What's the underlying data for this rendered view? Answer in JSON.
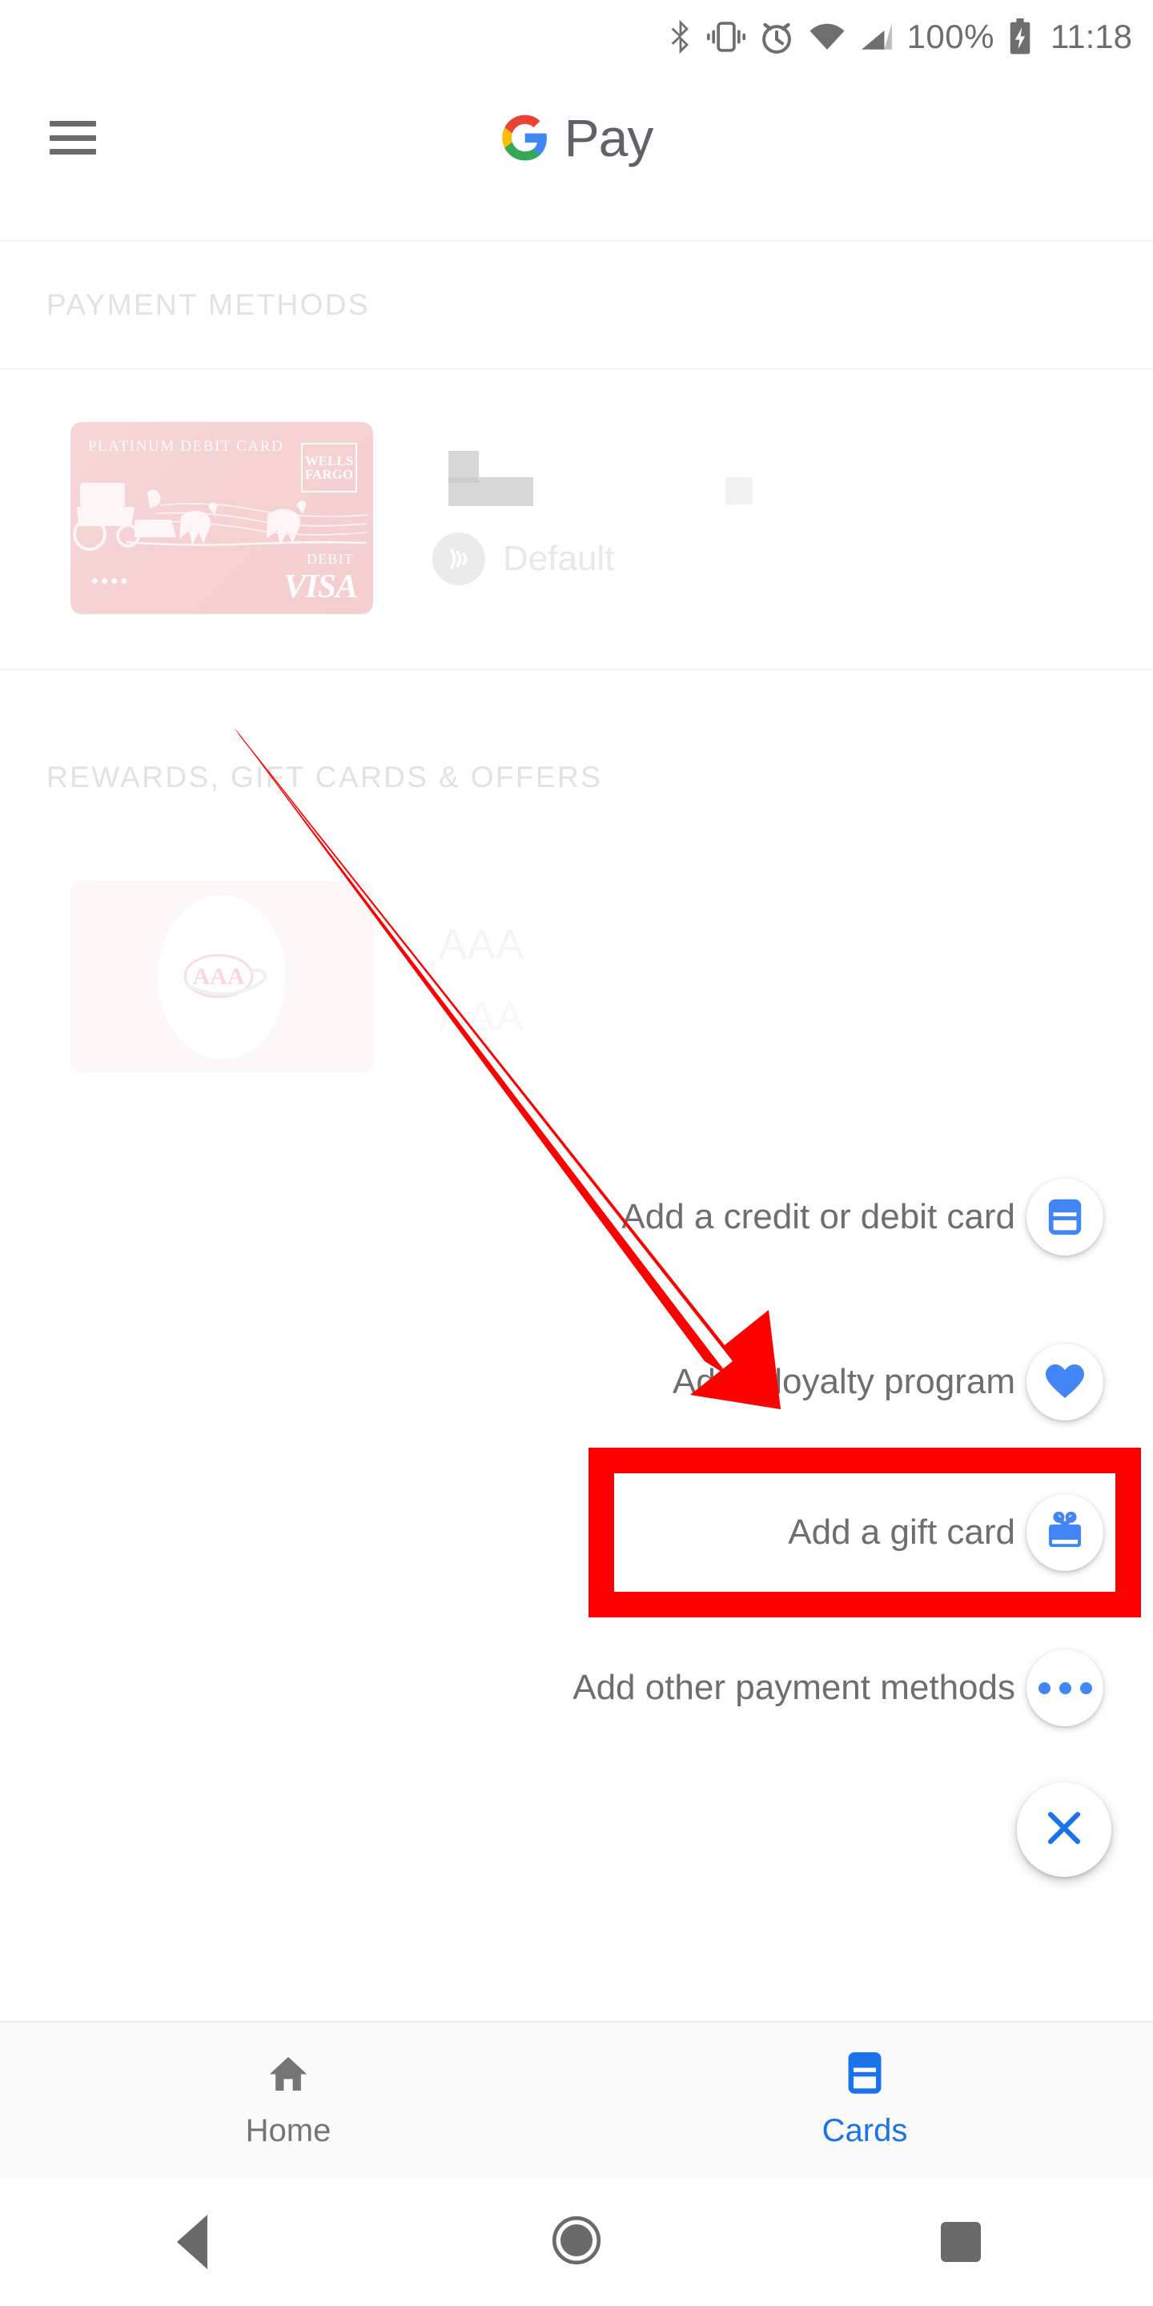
{
  "status_bar": {
    "icons": [
      "bluetooth-icon",
      "vibrate-icon",
      "alarm-icon",
      "wifi-icon",
      "cell-signal-icon"
    ],
    "battery_percent": "100%",
    "battery_state": "charging",
    "time": "11:18"
  },
  "app_bar": {
    "menu_icon": "hamburger-menu-icon",
    "brand_word": "Pay",
    "logo_icon": "google-g-logo"
  },
  "sections": [
    {
      "title": "PAYMENT METHODS"
    },
    {
      "title": "REWARDS, GIFT CARDS & OFFERS"
    }
  ],
  "payment_card": {
    "product_name": "PLATINUM DEBIT CARD",
    "bank_line1": "WELLS",
    "bank_line2": "FARGO",
    "masked_digits": "••••",
    "network_type": "DEBIT",
    "network": "VISA",
    "status_label": "Default",
    "status_icon": "contactless-nfc-icon"
  },
  "loyalty_card": {
    "name": "AAA",
    "secondary": "AAA",
    "logo_icon": "aaa-logo-icon"
  },
  "speed_dial": {
    "items": [
      {
        "label": "Add a credit or debit card",
        "icon": "credit-card-icon"
      },
      {
        "label": "Add a loyalty program",
        "icon": "heart-icon"
      },
      {
        "label": "Add a gift card",
        "icon": "gift-card-icon",
        "highlighted": true
      },
      {
        "label": "Add other payment methods",
        "icon": "more-horizontal-icon"
      }
    ],
    "close_icon": "close-x-icon"
  },
  "annotation": {
    "color": "#fd0000",
    "arrow_icon": "red-pointer-arrow",
    "box_target": "Add a gift card"
  },
  "bottom_nav": {
    "items": [
      {
        "label": "Home",
        "icon": "home-icon",
        "active": false
      },
      {
        "label": "Cards",
        "icon": "cards-icon",
        "active": true
      }
    ],
    "active_color": "#1a73e8",
    "inactive_color": "#757575"
  },
  "android_nav": {
    "back": "back-triangle-icon",
    "home": "home-circle-icon",
    "recents": "recents-square-icon"
  }
}
